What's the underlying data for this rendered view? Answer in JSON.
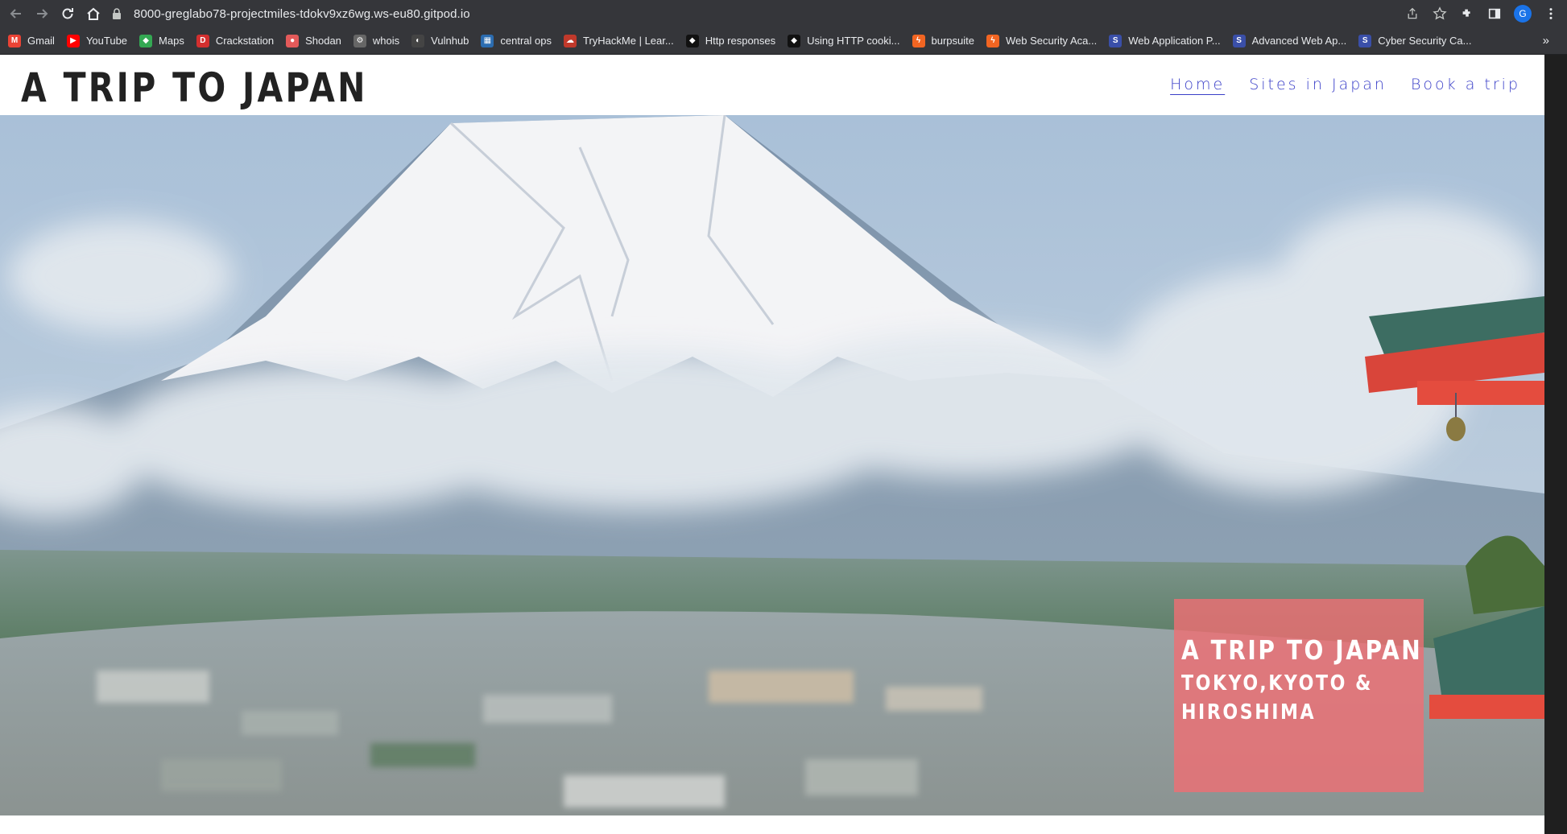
{
  "browser": {
    "url": "8000-greglabo78-projectmiles-tdokv9xz6wg.ws-eu80.gitpod.io",
    "profile_initial": "G",
    "icons": [
      "back-icon",
      "forward-icon",
      "reload-icon",
      "home-icon",
      "lock-icon",
      "share-icon",
      "star-icon",
      "extensions-icon",
      "side-panel-icon",
      "menu-icon"
    ],
    "bookmarks": [
      {
        "label": "Gmail",
        "color": "#ea4335",
        "glyph": "M"
      },
      {
        "label": "YouTube",
        "color": "#ff0000",
        "glyph": "▶"
      },
      {
        "label": "Maps",
        "color": "#34a853",
        "glyph": "◆"
      },
      {
        "label": "Crackstation",
        "color": "#d32f2f",
        "glyph": "D"
      },
      {
        "label": "Shodan",
        "color": "#e35a5a",
        "glyph": "●"
      },
      {
        "label": "whois",
        "color": "#666666",
        "glyph": "⚙"
      },
      {
        "label": "Vulnhub",
        "color": "#444444",
        "glyph": "◐"
      },
      {
        "label": "central ops",
        "color": "#2b6cb0",
        "glyph": "▦"
      },
      {
        "label": "TryHackMe | Lear...",
        "color": "#c0392b",
        "glyph": "☁"
      },
      {
        "label": "Http responses",
        "color": "#111111",
        "glyph": "◆"
      },
      {
        "label": "Using HTTP cooki...",
        "color": "#111111",
        "glyph": "◆"
      },
      {
        "label": "burpsuite",
        "color": "#f26522",
        "glyph": "ϟ"
      },
      {
        "label": "Web Security Aca...",
        "color": "#f26522",
        "glyph": "ϟ"
      },
      {
        "label": "Web Application P...",
        "color": "#3a4fa8",
        "glyph": "S"
      },
      {
        "label": "Advanced Web Ap...",
        "color": "#3a4fa8",
        "glyph": "S"
      },
      {
        "label": "Cyber Security Ca...",
        "color": "#3a4fa8",
        "glyph": "S"
      }
    ],
    "more_label": "»"
  },
  "site": {
    "logo": "A TRIP TO JAPAN",
    "nav": [
      {
        "label": "Home",
        "active": true
      },
      {
        "label": "Sites in Japan",
        "active": false
      },
      {
        "label": "Book a trip",
        "active": false
      }
    ],
    "link_color": "#3a3fc8",
    "hero": {
      "title": "A TRIP TO JAPAN",
      "subtitle": "TOKYO,KYOTO & HIROSHIMA",
      "caption_color": "#f06e73"
    }
  }
}
